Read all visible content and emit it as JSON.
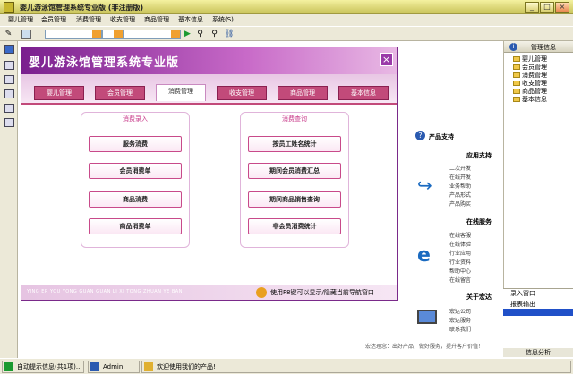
{
  "window": {
    "title": "婴儿游泳馆管理系统专业版 (非注册版)",
    "min": "_",
    "max": "□",
    "close": "×"
  },
  "menus": [
    "婴儿管理",
    "会员管理",
    "消费管理",
    "收支管理",
    "商品管理",
    "基本信息",
    "系统(S)"
  ],
  "dialog": {
    "title": "婴儿游泳馆管理系统专业版",
    "close": "×",
    "tabs": [
      "婴儿管理",
      "会员管理",
      "消费管理",
      "收支管理",
      "商品管理",
      "基本信息"
    ],
    "active_tab": 2,
    "groups": [
      {
        "title": "消费录入",
        "buttons": [
          "服务消费",
          "会员消费单",
          "商品消费",
          "商品消费单"
        ]
      },
      {
        "title": "消费查询",
        "buttons": [
          "按员工姓名统计",
          "期间会员消费汇总",
          "期间商品销售查询",
          "非会员消费统计"
        ]
      }
    ],
    "footer_pinyin": "YING ER YOU YONG GUAN GUAN LI XI TONG ZHUAN YE BAN",
    "hint": "使用F8键可以显示/隐藏当前导航窗口"
  },
  "right_panel": {
    "header": "产品支持",
    "sections": [
      {
        "title": "应用支持",
        "links": [
          "二次开发",
          "在线开发",
          "业务帮助",
          "产品形式",
          "产品购买"
        ]
      },
      {
        "title": "在线服务",
        "links": [
          "在线客服",
          "在线体验",
          "行业应用",
          "行业资料",
          "帮助中心",
          "在线留言"
        ]
      },
      {
        "title": "关于宏达",
        "links": [
          "宏达公司",
          "宏达服务",
          "联系我们"
        ]
      }
    ],
    "footer": "宏达理念：出好产品，做好服务，提升客户价值！"
  },
  "tree": {
    "header": "管理信息",
    "items": [
      "婴儿管理",
      "会员管理",
      "消费管理",
      "收支管理",
      "商品管理",
      "基本信息"
    ],
    "quick": [
      "录入窗口",
      "报表输出"
    ],
    "bottom": "信息分析"
  },
  "status": {
    "msg": "自动提示信息(共1项)...",
    "user": "Admin",
    "welcome": "欢迎使用我们的产品!"
  }
}
